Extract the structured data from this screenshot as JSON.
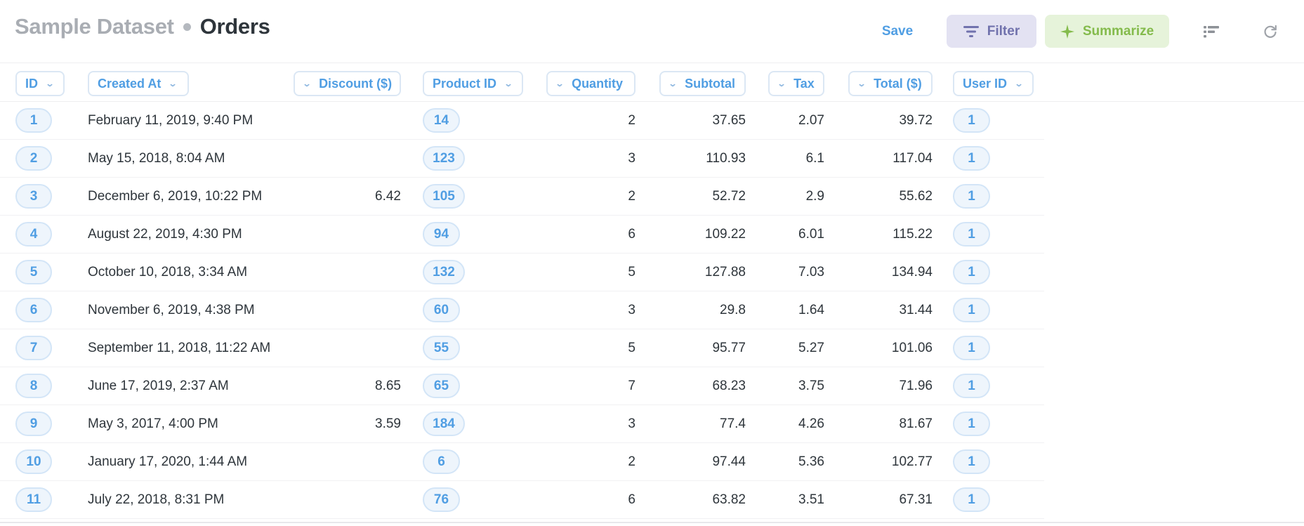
{
  "header": {
    "breadcrumb_parent": "Sample Dataset",
    "title": "Orders",
    "save_label": "Save",
    "filter_label": "Filter",
    "summarize_label": "Summarize",
    "icons": {
      "filter": "filter-icon",
      "summarize": "sparkle-icon",
      "view": "list-view-icon",
      "refresh": "refresh-icon"
    }
  },
  "colors": {
    "link": "#509ee3",
    "filter": "#7172ad",
    "summarize": "#84bb4c",
    "text": "#2e353b"
  },
  "table": {
    "columns": [
      {
        "label": "ID"
      },
      {
        "label": "Created At"
      },
      {
        "label": "Discount ($)"
      },
      {
        "label": "Product ID"
      },
      {
        "label": "Quantity"
      },
      {
        "label": "Subtotal"
      },
      {
        "label": "Tax"
      },
      {
        "label": "Total ($)"
      },
      {
        "label": "User ID"
      }
    ],
    "rows": [
      {
        "id": "1",
        "created_at": "February 11, 2019, 9:40 PM",
        "discount": "",
        "product_id": "14",
        "quantity": "2",
        "subtotal": "37.65",
        "tax": "2.07",
        "total": "39.72",
        "user_id": "1"
      },
      {
        "id": "2",
        "created_at": "May 15, 2018, 8:04 AM",
        "discount": "",
        "product_id": "123",
        "quantity": "3",
        "subtotal": "110.93",
        "tax": "6.1",
        "total": "117.04",
        "user_id": "1"
      },
      {
        "id": "3",
        "created_at": "December 6, 2019, 10:22 PM",
        "discount": "6.42",
        "product_id": "105",
        "quantity": "2",
        "subtotal": "52.72",
        "tax": "2.9",
        "total": "55.62",
        "user_id": "1"
      },
      {
        "id": "4",
        "created_at": "August 22, 2019, 4:30 PM",
        "discount": "",
        "product_id": "94",
        "quantity": "6",
        "subtotal": "109.22",
        "tax": "6.01",
        "total": "115.22",
        "user_id": "1"
      },
      {
        "id": "5",
        "created_at": "October 10, 2018, 3:34 AM",
        "discount": "",
        "product_id": "132",
        "quantity": "5",
        "subtotal": "127.88",
        "tax": "7.03",
        "total": "134.94",
        "user_id": "1"
      },
      {
        "id": "6",
        "created_at": "November 6, 2019, 4:38 PM",
        "discount": "",
        "product_id": "60",
        "quantity": "3",
        "subtotal": "29.8",
        "tax": "1.64",
        "total": "31.44",
        "user_id": "1"
      },
      {
        "id": "7",
        "created_at": "September 11, 2018, 11:22 AM",
        "discount": "",
        "product_id": "55",
        "quantity": "5",
        "subtotal": "95.77",
        "tax": "5.27",
        "total": "101.06",
        "user_id": "1"
      },
      {
        "id": "8",
        "created_at": "June 17, 2019, 2:37 AM",
        "discount": "8.65",
        "product_id": "65",
        "quantity": "7",
        "subtotal": "68.23",
        "tax": "3.75",
        "total": "71.96",
        "user_id": "1"
      },
      {
        "id": "9",
        "created_at": "May 3, 2017, 4:00 PM",
        "discount": "3.59",
        "product_id": "184",
        "quantity": "3",
        "subtotal": "77.4",
        "tax": "4.26",
        "total": "81.67",
        "user_id": "1"
      },
      {
        "id": "10",
        "created_at": "January 17, 2020, 1:44 AM",
        "discount": "",
        "product_id": "6",
        "quantity": "2",
        "subtotal": "97.44",
        "tax": "5.36",
        "total": "102.77",
        "user_id": "1"
      },
      {
        "id": "11",
        "created_at": "July 22, 2018, 8:31 PM",
        "discount": "",
        "product_id": "76",
        "quantity": "6",
        "subtotal": "63.82",
        "tax": "3.51",
        "total": "67.31",
        "user_id": "1"
      }
    ]
  }
}
